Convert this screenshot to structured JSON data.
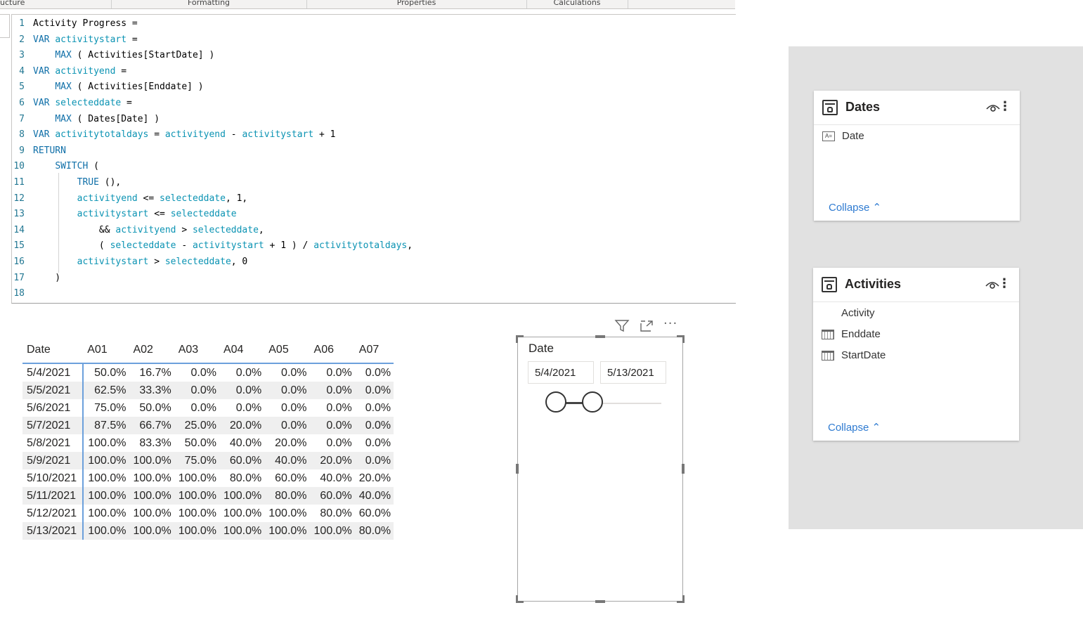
{
  "ribbon": {
    "tabs": [
      {
        "label": "ucture"
      },
      {
        "label": "Formatting"
      },
      {
        "label": "Properties"
      },
      {
        "label": "Calculations"
      }
    ]
  },
  "editor": {
    "lines": [
      {
        "n": "1",
        "t": "Activity Progress ="
      },
      {
        "n": "2",
        "t": "VAR activitystart ="
      },
      {
        "n": "3",
        "t": "    MAX ( Activities[StartDate] )"
      },
      {
        "n": "4",
        "t": "VAR activityend ="
      },
      {
        "n": "5",
        "t": "    MAX ( Activities[Enddate] )"
      },
      {
        "n": "6",
        "t": "VAR selecteddate ="
      },
      {
        "n": "7",
        "t": "    MAX ( Dates[Date] )"
      },
      {
        "n": "8",
        "t": "VAR activitytotaldays = activityend - activitystart + 1"
      },
      {
        "n": "9",
        "t": "RETURN"
      },
      {
        "n": "10",
        "t": "    SWITCH ("
      },
      {
        "n": "11",
        "t": "        TRUE (),"
      },
      {
        "n": "12",
        "t": "        activityend <= selecteddate, 1,"
      },
      {
        "n": "13",
        "t": "        activitystart <= selecteddate"
      },
      {
        "n": "14",
        "t": "            && activityend > selecteddate,"
      },
      {
        "n": "15",
        "t": "            ( selecteddate - activitystart + 1 ) / activitytotaldays,"
      },
      {
        "n": "16",
        "t": "        activitystart > selecteddate, 0"
      },
      {
        "n": "17",
        "t": "    )"
      },
      {
        "n": "18",
        "t": ""
      }
    ]
  },
  "matrix": {
    "headers": [
      "Date",
      "A01",
      "A02",
      "A03",
      "A04",
      "A05",
      "A06",
      "A07"
    ],
    "rows": [
      [
        "5/4/2021",
        "50.0%",
        "16.7%",
        "0.0%",
        "0.0%",
        "0.0%",
        "0.0%",
        "0.0%"
      ],
      [
        "5/5/2021",
        "62.5%",
        "33.3%",
        "0.0%",
        "0.0%",
        "0.0%",
        "0.0%",
        "0.0%"
      ],
      [
        "5/6/2021",
        "75.0%",
        "50.0%",
        "0.0%",
        "0.0%",
        "0.0%",
        "0.0%",
        "0.0%"
      ],
      [
        "5/7/2021",
        "87.5%",
        "66.7%",
        "25.0%",
        "20.0%",
        "0.0%",
        "0.0%",
        "0.0%"
      ],
      [
        "5/8/2021",
        "100.0%",
        "83.3%",
        "50.0%",
        "40.0%",
        "20.0%",
        "0.0%",
        "0.0%"
      ],
      [
        "5/9/2021",
        "100.0%",
        "100.0%",
        "75.0%",
        "60.0%",
        "40.0%",
        "20.0%",
        "0.0%"
      ],
      [
        "5/10/2021",
        "100.0%",
        "100.0%",
        "100.0%",
        "80.0%",
        "60.0%",
        "40.0%",
        "20.0%"
      ],
      [
        "5/11/2021",
        "100.0%",
        "100.0%",
        "100.0%",
        "100.0%",
        "80.0%",
        "60.0%",
        "40.0%"
      ],
      [
        "5/12/2021",
        "100.0%",
        "100.0%",
        "100.0%",
        "100.0%",
        "100.0%",
        "80.0%",
        "60.0%"
      ],
      [
        "5/13/2021",
        "100.0%",
        "100.0%",
        "100.0%",
        "100.0%",
        "100.0%",
        "100.0%",
        "80.0%"
      ]
    ]
  },
  "slicer": {
    "title": "Date",
    "start": "5/4/2021",
    "end": "5/13/2021",
    "header_icons": [
      "filter-icon",
      "focus-mode-icon",
      "more-options-icon"
    ]
  },
  "model": {
    "tables": [
      {
        "name": "Dates",
        "fields": [
          {
            "name": "Date",
            "icon": "text-field-icon"
          }
        ],
        "collapse_label": "Collapse"
      },
      {
        "name": "Activities",
        "fields": [
          {
            "name": "Activity",
            "icon": ""
          },
          {
            "name": "Enddate",
            "icon": "calendar-icon"
          },
          {
            "name": "StartDate",
            "icon": "calendar-icon"
          }
        ],
        "collapse_label": "Collapse"
      }
    ]
  },
  "colors": {
    "keyword": "#0f6fa8",
    "variable": "#0b93b3",
    "table_accent": "#6ca0dc",
    "link": "#2f7bd1",
    "model_bg": "#e1e1e1"
  }
}
